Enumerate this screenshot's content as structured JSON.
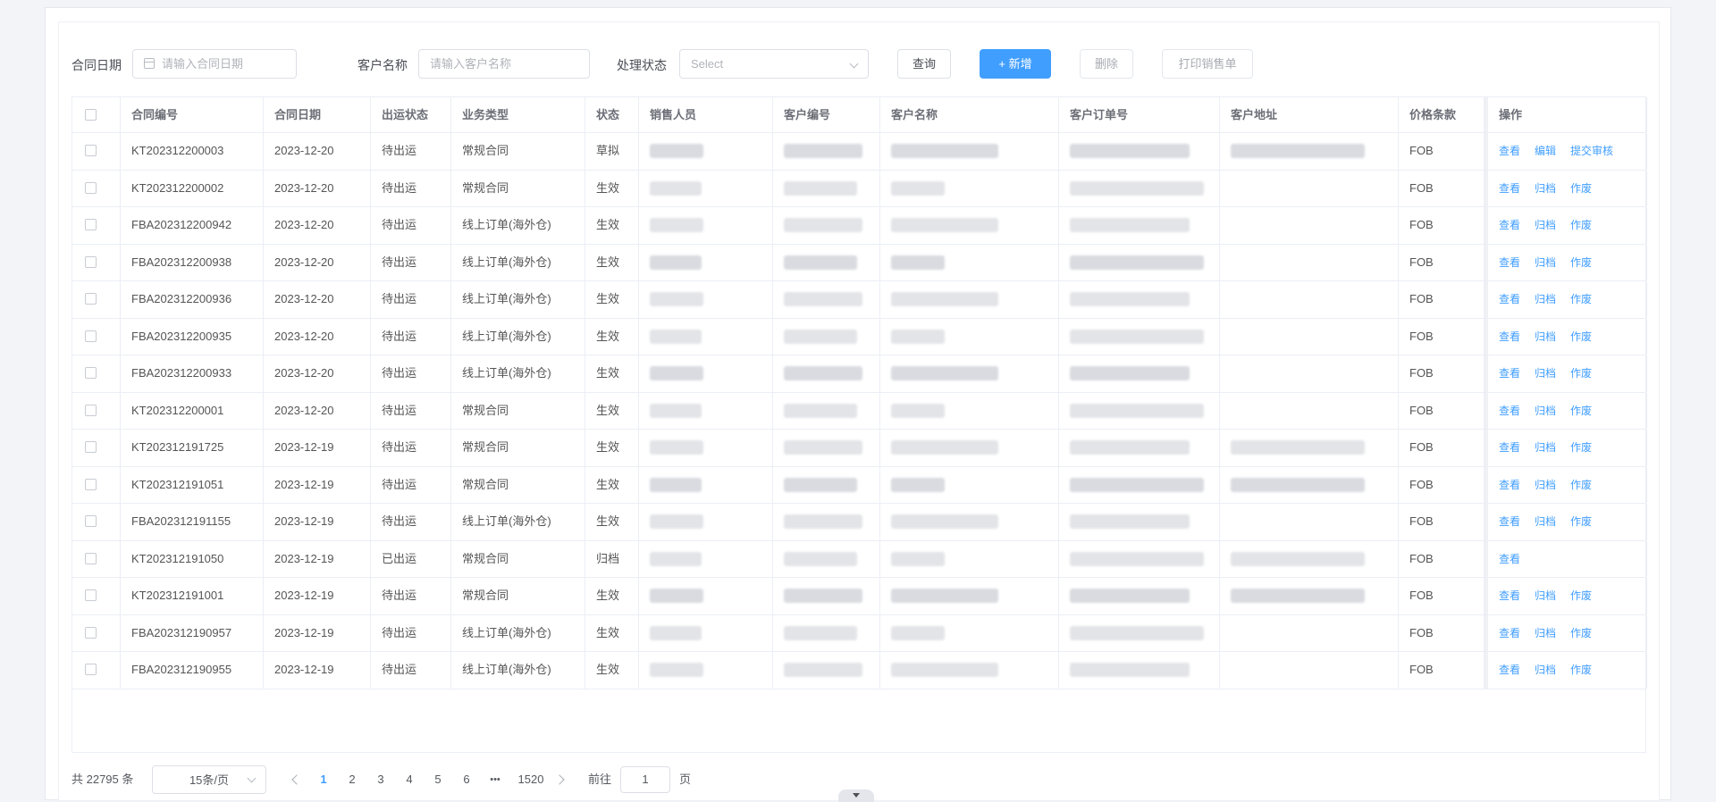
{
  "filters": {
    "date_label": "合同日期",
    "date_placeholder": "请输入合同日期",
    "customer_label": "客户名称",
    "customer_placeholder": "请输入客户名称",
    "status_label": "处理状态",
    "status_placeholder": "Select"
  },
  "buttons": {
    "query": "查询",
    "add": "+ 新增",
    "delete": "删除",
    "print": "打印销售单"
  },
  "columns": [
    "合同编号",
    "合同日期",
    "出运状态",
    "业务类型",
    "状态",
    "销售人员",
    "客户编号",
    "客户名称",
    "客户订单号",
    "客户地址",
    "价格条款",
    "操作"
  ],
  "rows": [
    {
      "code": "KT202312200003",
      "date": "2023-12-20",
      "ship": "待出运",
      "type": "常规合同",
      "status": "草拟",
      "price": "FOB",
      "ops": [
        "查看",
        "编辑",
        "提交审核"
      ]
    },
    {
      "code": "KT202312200002",
      "date": "2023-12-20",
      "ship": "待出运",
      "type": "常规合同",
      "status": "生效",
      "price": "FOB",
      "ops": [
        "查看",
        "归档",
        "作废"
      ]
    },
    {
      "code": "FBA202312200942",
      "date": "2023-12-20",
      "ship": "待出运",
      "type": "线上订单(海外仓)",
      "status": "生效",
      "price": "FOB",
      "ops": [
        "查看",
        "归档",
        "作废"
      ]
    },
    {
      "code": "FBA202312200938",
      "date": "2023-12-20",
      "ship": "待出运",
      "type": "线上订单(海外仓)",
      "status": "生效",
      "price": "FOB",
      "ops": [
        "查看",
        "归档",
        "作废"
      ]
    },
    {
      "code": "FBA202312200936",
      "date": "2023-12-20",
      "ship": "待出运",
      "type": "线上订单(海外仓)",
      "status": "生效",
      "price": "FOB",
      "ops": [
        "查看",
        "归档",
        "作废"
      ]
    },
    {
      "code": "FBA202312200935",
      "date": "2023-12-20",
      "ship": "待出运",
      "type": "线上订单(海外仓)",
      "status": "生效",
      "price": "FOB",
      "ops": [
        "查看",
        "归档",
        "作废"
      ]
    },
    {
      "code": "FBA202312200933",
      "date": "2023-12-20",
      "ship": "待出运",
      "type": "线上订单(海外仓)",
      "status": "生效",
      "price": "FOB",
      "ops": [
        "查看",
        "归档",
        "作废"
      ]
    },
    {
      "code": "KT202312200001",
      "date": "2023-12-20",
      "ship": "待出运",
      "type": "常规合同",
      "status": "生效",
      "price": "FOB",
      "ops": [
        "查看",
        "归档",
        "作废"
      ]
    },
    {
      "code": "KT202312191725",
      "date": "2023-12-19",
      "ship": "待出运",
      "type": "常规合同",
      "status": "生效",
      "price": "FOB",
      "ops": [
        "查看",
        "归档",
        "作废"
      ]
    },
    {
      "code": "KT202312191051",
      "date": "2023-12-19",
      "ship": "待出运",
      "type": "常规合同",
      "status": "生效",
      "price": "FOB",
      "ops": [
        "查看",
        "归档",
        "作废"
      ]
    },
    {
      "code": "FBA202312191155",
      "date": "2023-12-19",
      "ship": "待出运",
      "type": "线上订单(海外仓)",
      "status": "生效",
      "price": "FOB",
      "ops": [
        "查看",
        "归档",
        "作废"
      ]
    },
    {
      "code": "KT202312191050",
      "date": "2023-12-19",
      "ship": "已出运",
      "type": "常规合同",
      "status": "归档",
      "price": "FOB",
      "ops": [
        "查看"
      ]
    },
    {
      "code": "KT202312191001",
      "date": "2023-12-19",
      "ship": "待出运",
      "type": "常规合同",
      "status": "生效",
      "price": "FOB",
      "ops": [
        "查看",
        "归档",
        "作废"
      ]
    },
    {
      "code": "FBA202312190957",
      "date": "2023-12-19",
      "ship": "待出运",
      "type": "线上订单(海外仓)",
      "status": "生效",
      "price": "FOB",
      "ops": [
        "查看",
        "归档",
        "作废"
      ]
    },
    {
      "code": "FBA202312190955",
      "date": "2023-12-19",
      "ship": "待出运",
      "type": "线上订单(海外仓)",
      "status": "生效",
      "price": "FOB",
      "ops": [
        "查看",
        "归档",
        "作废"
      ]
    }
  ],
  "pagination": {
    "total": "共 22795 条",
    "page_size": "15条/页",
    "pages": [
      "1",
      "2",
      "3",
      "4",
      "5",
      "6"
    ],
    "ellipsis": "•••",
    "last_page": "1520",
    "goto_label": "前往",
    "goto_value": "1",
    "goto_suffix": "页"
  }
}
